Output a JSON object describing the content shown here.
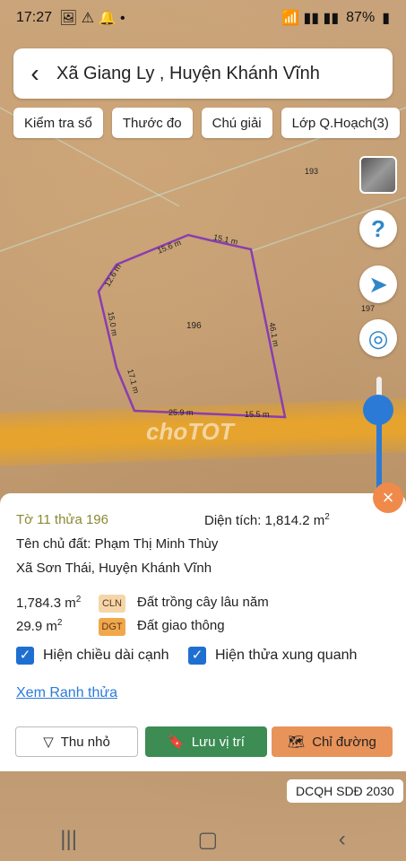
{
  "status_bar": {
    "time": "17:27",
    "battery": "87%"
  },
  "header": {
    "title": "Xã Giang Ly , Huyện Khánh Vĩnh"
  },
  "toolbar": {
    "check_book": "Kiểm tra sổ",
    "ruler": "Thước đo",
    "legend": "Chú giải",
    "planning_layer": "Lớp Q.Hoạch(3)"
  },
  "map": {
    "parcel_number": "196",
    "neighbor_labels": [
      "193",
      "197"
    ],
    "edge_lengths": [
      "15.6 m",
      "15.1 m",
      "12.6 m",
      "15.0 m",
      "46.1 m",
      "17.1 m",
      "25.9 m",
      "15.5 m"
    ],
    "watermark": "choTOT",
    "boundary_color": "#8a3db0",
    "road_color": "#e9a428"
  },
  "panel": {
    "parcel_info": "Tờ 11 thửa 196",
    "area_label": "Diện tích:",
    "area_value": "1,814.2 m",
    "area_unit_exp": "2",
    "owner_label": "Tên chủ đất:",
    "owner_name": "Phạm Thị Minh Thùy",
    "address": "Xã Sơn Thái, Huyện Khánh Vĩnh",
    "land_uses": [
      {
        "area": "1,784.3 m",
        "exp": "2",
        "code": "CLN",
        "desc": "Đất trồng cây lâu năm",
        "color": "#f5d6a8"
      },
      {
        "area": "29.9 m",
        "exp": "2",
        "code": "DGT",
        "desc": "Đất giao thông",
        "color": "#f0a84a"
      }
    ],
    "show_edge_lengths": "Hiện chiều dài cạnh",
    "show_neighbors": "Hiện thửa xung quanh",
    "view_boundary": "Xem Ranh thửa",
    "collapse": "Thu nhỏ",
    "save_location": "Lưu vị trí",
    "directions": "Chỉ đường"
  },
  "footer_tag": "DCQH SDĐ 2030",
  "colors": {
    "green_button": "#3c8c54",
    "orange_button": "#e8935a",
    "accent_blue": "#2b7bd6"
  }
}
